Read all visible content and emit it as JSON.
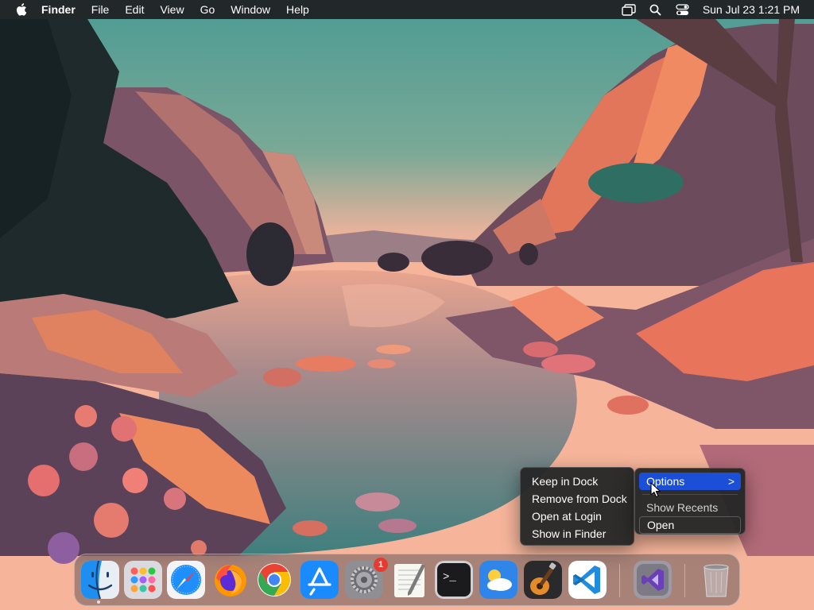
{
  "menubar": {
    "apple_icon": "apple-logo",
    "app_name": "Finder",
    "menus": [
      "File",
      "Edit",
      "View",
      "Go",
      "Window",
      "Help"
    ],
    "status_icons": [
      "screen-mirroring-icon",
      "search-icon",
      "control-center-icon"
    ],
    "clock": "Sun Jul 23  1:21 PM"
  },
  "context_menu": {
    "items": [
      "Keep in Dock",
      "Remove from Dock",
      "Open at Login",
      "Show in Finder"
    ]
  },
  "submenu": {
    "options_label": "Options",
    "options_chevron": ">",
    "show_recents": "Show Recents",
    "open": "Open"
  },
  "dock": {
    "apps": [
      {
        "name": "Finder",
        "icon": "finder-icon"
      },
      {
        "name": "Launchpad",
        "icon": "launchpad-icon"
      },
      {
        "name": "Safari",
        "icon": "safari-icon"
      },
      {
        "name": "Firefox",
        "icon": "firefox-icon"
      },
      {
        "name": "Google Chrome",
        "icon": "chrome-icon"
      },
      {
        "name": "App Store",
        "icon": "app-store-icon"
      },
      {
        "name": "System Settings",
        "icon": "settings-gear-icon"
      },
      {
        "name": "TextEdit",
        "icon": "textedit-icon"
      },
      {
        "name": "Terminal",
        "icon": "terminal-icon"
      },
      {
        "name": "Weather",
        "icon": "weather-icon"
      },
      {
        "name": "GarageBand",
        "icon": "guitar-icon"
      },
      {
        "name": "Visual Studio Code",
        "icon": "vscode-icon"
      },
      {
        "name": "Visual Studio",
        "icon": "visual-studio-icon"
      },
      {
        "name": "Trash",
        "icon": "trash-icon"
      }
    ],
    "settings_badge": "1",
    "terminal_prompt": ">_"
  },
  "colors": {
    "menu_highlight": "#1b4fd8",
    "badge": "#e53b30",
    "menubar_bg": "#1e1e20"
  }
}
